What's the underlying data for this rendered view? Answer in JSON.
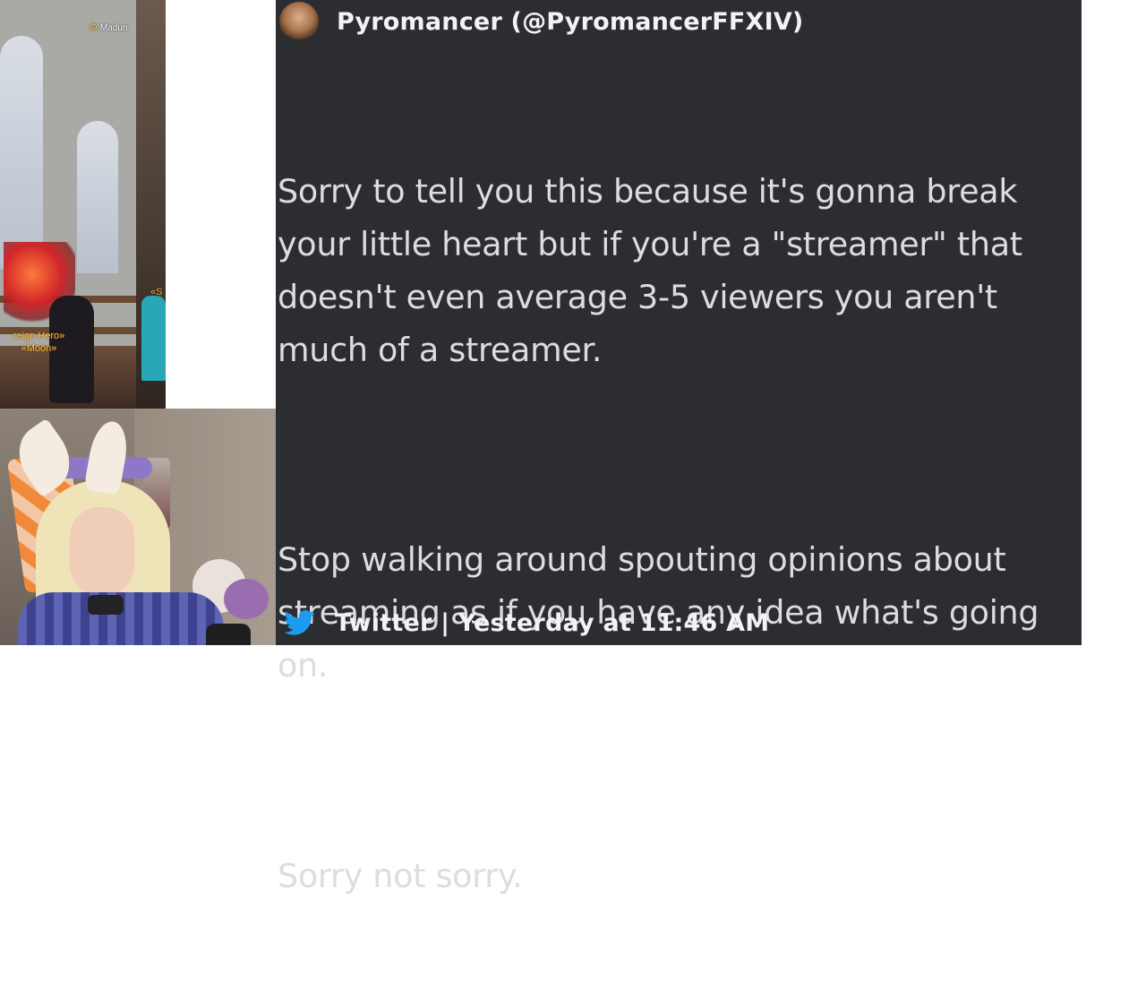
{
  "game": {
    "hud_player": "Madun",
    "nameplate_title": "reign Hero»",
    "nameplate_name": "«Moon»",
    "nameplate_right": "«S"
  },
  "tweet": {
    "author": "Pyromancer (@PyromancerFFXIV)",
    "paragraphs": [
      "Sorry to tell you this because it's gonna break your little heart but if you're a \"streamer\" that doesn't even average 3-5 viewers you aren't much of a streamer.",
      "Stop walking around spouting opinions about streaming as if you have any idea what's going on.",
      "Sorry not sorry."
    ],
    "footer": "Twitter | Yesterday at 11:46 AM",
    "twitter_color": "#1d9bf0"
  },
  "icons": {
    "footer_icon": "twitter-bird-icon",
    "hud_icon": "headset-icon"
  }
}
